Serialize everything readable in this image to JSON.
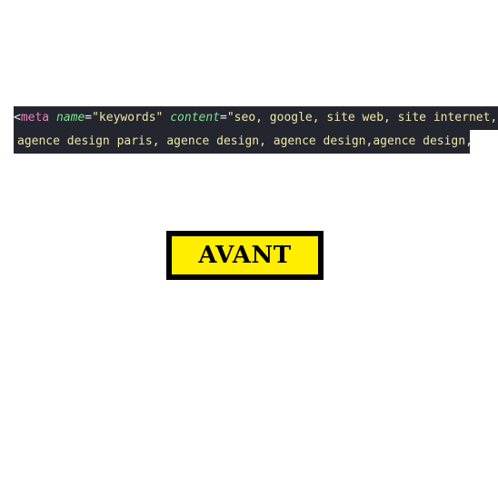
{
  "code_snippet": {
    "line1": {
      "open_bracket": "<",
      "tag": "meta",
      "attr1_name": "name",
      "equals1": "=",
      "attr1_value": "\"keywords\"",
      "space": " ",
      "attr2_name": "content",
      "equals2": "=",
      "attr2_value": "\"seo, google, site web, site internet, a"
    },
    "line2": {
      "text": "agence design paris, agence design, agence design,agence design,a"
    },
    "colors": {
      "background": "#23252f",
      "tag": "#f07ec5",
      "attribute": "#7ee28a",
      "string": "#ece8a6"
    }
  },
  "badge": {
    "label": "AVANT",
    "background_color": "#ffee00",
    "border_color": "#000000"
  }
}
